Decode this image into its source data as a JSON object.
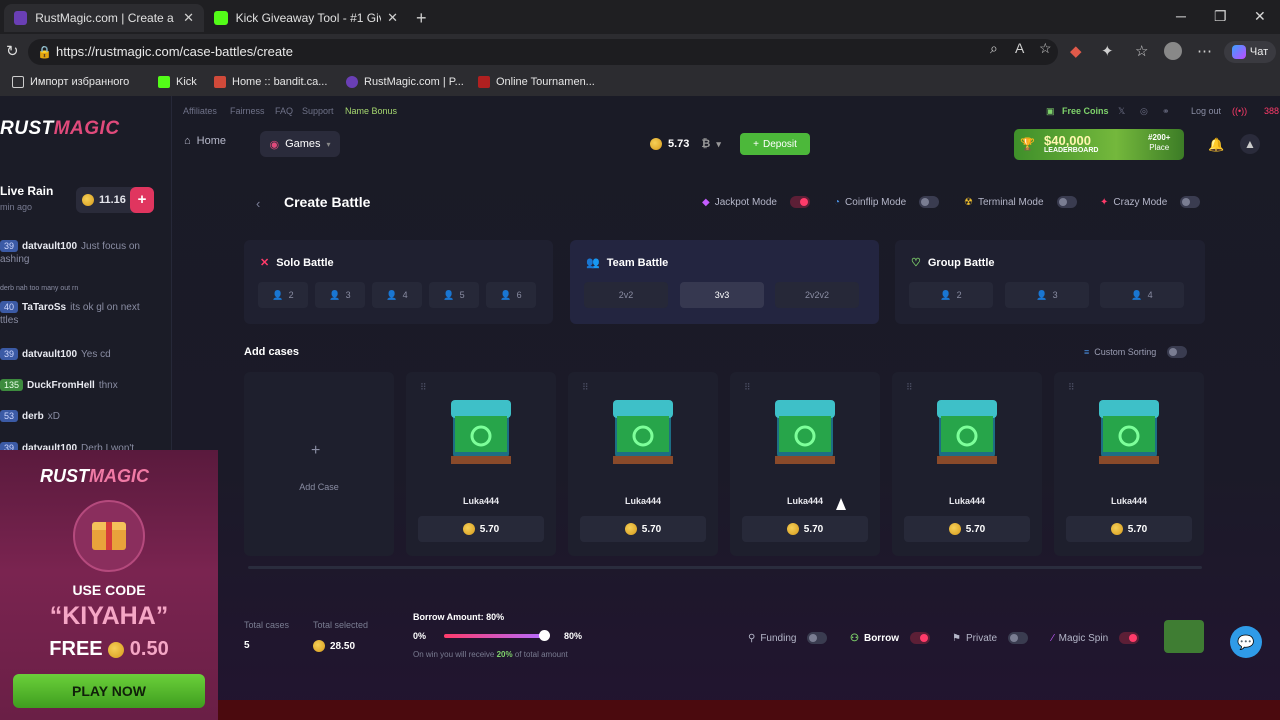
{
  "browser": {
    "tabs": [
      {
        "title": "RustMagic.com | Create a case bat",
        "active": true
      },
      {
        "title": "Kick Giveaway Tool - #1 Giveaway",
        "active": false
      }
    ],
    "url": "https://rustmagic.com/case-battles/create",
    "chat_label": "Чат",
    "bookmarks": [
      "Импорт избранного",
      "Kick",
      "Home :: bandit.ca...",
      "RustMagic.com | P...",
      "Online Tournamen..."
    ]
  },
  "sidebar": {
    "logo": {
      "rust": "RUST",
      "magic": "MAGIC"
    },
    "live_rain": {
      "title": "Live Rain",
      "sub": "min ago",
      "amount": "11.16",
      "plus": "+"
    },
    "messages": [
      {
        "level": "39",
        "name": "datvault100",
        "text": "Just focus on",
        "cont": "ashing"
      },
      {
        "reply": "derb nah too many out rn",
        "level": "40",
        "name": "TaTaroSs",
        "text": "its ok gl on next",
        "cont": "ttles"
      },
      {
        "level": "39",
        "name": "datvault100",
        "text": "Yes cd"
      },
      {
        "level": "135",
        "name": "DuckFromHell",
        "text": "thnx"
      },
      {
        "level": "53",
        "name": "derb",
        "text": "xD"
      },
      {
        "level": "39",
        "name": "datvault100",
        "text": "Derb I won't"
      }
    ],
    "promo": {
      "logo_rust": "RUST",
      "logo_magic": "MAGIC",
      "use_code": "USE CODE",
      "code": "“KIYAHA”",
      "free": "FREE",
      "free_amount": "0.50",
      "play": "PLAY NOW"
    }
  },
  "topnav": {
    "links": [
      "Affiliates",
      "Fairness",
      "FAQ",
      "Support"
    ],
    "name_bonus": "Name Bonus",
    "free_coins": "Free Coins",
    "logout": "Log out",
    "online": "388"
  },
  "mainnav": {
    "home": "Home",
    "games": "Games",
    "balance": "5.73",
    "deposit": "Deposit",
    "leaderboard": {
      "amount": "$40,000",
      "label": "LEADERBOARD",
      "place": "#200+",
      "place_label": "Place"
    }
  },
  "battle": {
    "title": "Create Battle",
    "modes": [
      {
        "label": "Jackpot Mode",
        "on": true
      },
      {
        "label": "Coinflip Mode",
        "on": false
      },
      {
        "label": "Terminal Mode",
        "on": false
      },
      {
        "label": "Crazy Mode",
        "on": false
      }
    ],
    "solo": {
      "title": "Solo Battle",
      "options": [
        "2",
        "3",
        "4",
        "5",
        "6"
      ]
    },
    "team": {
      "title": "Team Battle",
      "options": [
        "2v2",
        "3v3",
        "2v2v2"
      ],
      "selected": "3v3"
    },
    "group": {
      "title": "Group Battle",
      "options": [
        "2",
        "3",
        "4"
      ]
    },
    "add_cases": "Add cases",
    "custom_sorting": "Custom Sorting",
    "add_case": "Add Case",
    "cases": [
      {
        "name": "Luka444",
        "price": "5.70"
      },
      {
        "name": "Luka444",
        "price": "5.70"
      },
      {
        "name": "Luka444",
        "price": "5.70"
      },
      {
        "name": "Luka444",
        "price": "5.70"
      },
      {
        "name": "Luka444",
        "price": "5.70"
      }
    ]
  },
  "footer": {
    "total_cases_label": "Total cases",
    "total_cases": "5",
    "total_selected_label": "Total selected",
    "total_selected": "28.50",
    "borrow_title": "Borrow Amount: 80%",
    "borrow_min": "0%",
    "borrow_max": "80%",
    "borrow_fraction": 1.0,
    "win_note_pre": "On win you will receive",
    "win_note_pct": "20%",
    "win_note_post": "of total amount",
    "toggles": [
      {
        "label": "Funding",
        "on": false
      },
      {
        "label": "Borrow",
        "on": true
      },
      {
        "label": "Private",
        "on": false
      },
      {
        "label": "Magic Spin",
        "on": true
      }
    ]
  },
  "colors": {
    "accent": "#ff3b6a",
    "green": "#4cb83a",
    "brand_magic": "#e04a7b"
  }
}
